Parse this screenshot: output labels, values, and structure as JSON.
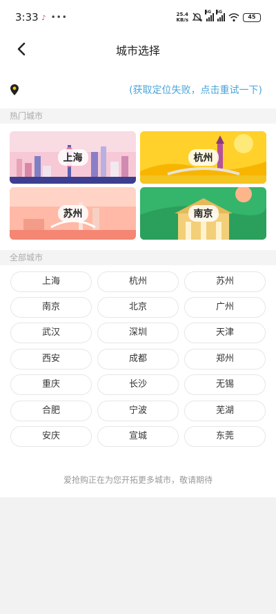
{
  "status_bar": {
    "time": "3:33",
    "network_speed_value": "25.4",
    "network_speed_unit": "KB/s",
    "signal_tag_1": "5G",
    "signal_tag_2": "5G",
    "battery": "45",
    "icons": [
      "tiktok-icon",
      "more-dots-icon",
      "mute-icon",
      "signal-icon",
      "wifi-icon",
      "battery-icon"
    ]
  },
  "header": {
    "title": "城市选择",
    "back_icon": "chevron-left-icon"
  },
  "location": {
    "icon": "location-pin-icon",
    "status_text": "(获取定位失败，点击重试一下)",
    "accent_color": "#4aa6d9"
  },
  "hot_cities": {
    "section_title": "热门城市",
    "items": [
      {
        "label": "上海"
      },
      {
        "label": "杭州"
      },
      {
        "label": "苏州"
      },
      {
        "label": "南京"
      }
    ]
  },
  "all_cities": {
    "section_title": "全部城市",
    "items": [
      "上海",
      "杭州",
      "苏州",
      "南京",
      "北京",
      "广州",
      "武汉",
      "深圳",
      "天津",
      "西安",
      "成都",
      "郑州",
      "重庆",
      "长沙",
      "无锡",
      "合肥",
      "宁波",
      "芜湖",
      "安庆",
      "宣城",
      "东莞"
    ]
  },
  "footer_note": "爱抢购正在为您开拓更多城市，敬请期待"
}
